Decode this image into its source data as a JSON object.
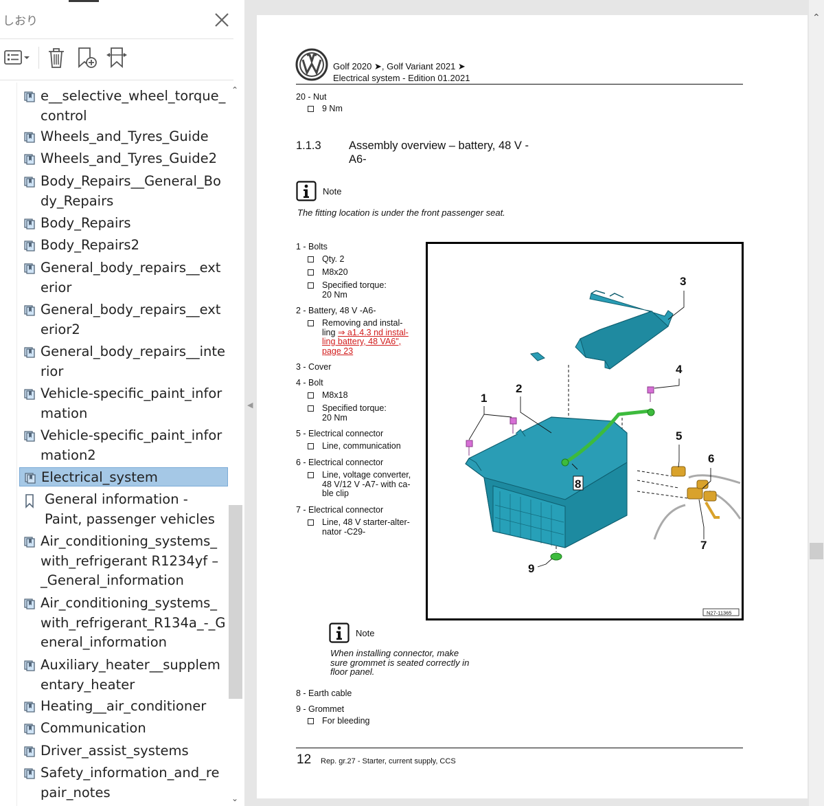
{
  "panel": {
    "title": "しおり",
    "close_icon": "close-icon",
    "toolbar": {
      "options_icon": "bookmark-options-icon",
      "delete_icon": "trash-icon",
      "new_bookmark_icon": "new-bookmark-icon",
      "expand_icon": "expand-bookmark-icon"
    }
  },
  "bookmarks": [
    {
      "label": "e__selective_wheel_torque_control",
      "icon": "bookmark-pages-icon"
    },
    {
      "label": "Wheels_and_Tyres_Guide",
      "icon": "bookmark-pages-icon"
    },
    {
      "label": "Wheels_and_Tyres_Guide2",
      "icon": "bookmark-pages-icon"
    },
    {
      "label": "Body_Repairs__General_Body_Repairs",
      "icon": "bookmark-pages-icon"
    },
    {
      "label": "Body_Repairs",
      "icon": "bookmark-pages-icon"
    },
    {
      "label": "Body_Repairs2",
      "icon": "bookmark-pages-icon"
    },
    {
      "label": "General_body_repairs__exterior",
      "icon": "bookmark-pages-icon"
    },
    {
      "label": "General_body_repairs__exterior2",
      "icon": "bookmark-pages-icon"
    },
    {
      "label": "General_body_repairs__interior",
      "icon": "bookmark-pages-icon"
    },
    {
      "label": "Vehicle-specific_paint_information",
      "icon": "bookmark-pages-icon"
    },
    {
      "label": "Vehicle-specific_paint_information2",
      "icon": "bookmark-pages-icon"
    },
    {
      "label": "Electrical_system",
      "icon": "bookmark-pages-icon",
      "selected": true
    },
    {
      "label": "General information - Paint, passenger vehicles",
      "icon": "bookmark-icon"
    },
    {
      "label": "Air_conditioning_systems_with_refrigerant R1234yf – _General_information",
      "icon": "bookmark-pages-icon"
    },
    {
      "label": "Air_conditioning_systems_with_refrigerant_R134a_-_General_information",
      "icon": "bookmark-pages-icon"
    },
    {
      "label": "Auxiliary_heater__supplementary_heater",
      "icon": "bookmark-pages-icon"
    },
    {
      "label": "Heating__air_conditioner",
      "icon": "bookmark-pages-icon"
    },
    {
      "label": "Communication",
      "icon": "bookmark-pages-icon"
    },
    {
      "label": "Driver_assist_systems",
      "icon": "bookmark-pages-icon"
    },
    {
      "label": "Safety_information_and_repair_notes",
      "icon": "bookmark-pages-icon"
    }
  ],
  "page": {
    "header": {
      "logo_icon": "vw-logo-icon",
      "line1": "Golf 2020 ➤, Golf Variant 2021 ➤",
      "line2": "Electrical system - Edition 01.2021"
    },
    "prev_item": {
      "title": "20 - Nut",
      "detail": "9 Nm"
    },
    "section": {
      "number": "1.1.3",
      "title_line1": "Assembly overview – battery, 48 V -",
      "title_line2": "A6-"
    },
    "note1": {
      "label": "Note",
      "text": "The fitting location is under the front passenger seat.",
      "icon": "info-note-icon"
    },
    "items": {
      "i1": {
        "title": "1 - Bolts",
        "d1": "Qty. 2",
        "d2": "M8x20",
        "d3a": "Specified torque:",
        "d3b": "20 Nm"
      },
      "i2": {
        "title": "2 - Battery, 48 V -A6-",
        "d1a": "Removing and instal-",
        "d1b": "ling ",
        "link1": "⇒ a1.4.3 nd instal-",
        "link2": "ling battery, 48 VA6\",",
        "link3": "page 23"
      },
      "i3": {
        "title": "3 - Cover"
      },
      "i4": {
        "title": "4 - Bolt",
        "d1": "M8x18",
        "d2a": "Specified torque:",
        "d2b": "20 Nm"
      },
      "i5": {
        "title": "5 - Electrical connector",
        "d1": "Line, communication"
      },
      "i6": {
        "title": "6 - Electrical connector",
        "d1a": "Line, voltage converter,",
        "d1b": "48 V/12 V -A7- with ca-",
        "d1c": "ble clip"
      },
      "i7": {
        "title": "7 - Electrical connector",
        "d1a": "Line, 48 V starter-alter-",
        "d1b": "nator -C29-"
      },
      "i8": {
        "title": "8 - Earth cable"
      },
      "i9": {
        "title": "9 - Grommet",
        "d1": "For bleeding"
      }
    },
    "figure": {
      "ref": "N27-11365",
      "callouts": [
        "1",
        "2",
        "3",
        "4",
        "5",
        "6",
        "7",
        "8",
        "9"
      ]
    },
    "note2": {
      "label": "Note",
      "line1": "When installing connector, make",
      "line2": "sure grommet is seated correctly in",
      "line3": "floor panel.",
      "icon": "info-note-icon"
    },
    "footer": {
      "page_number": "12",
      "text": "Rep. gr.27 - Starter, current supply, CCS"
    }
  },
  "colors": {
    "battery": "#2a9db5",
    "earth_cable": "#3dbb3d",
    "bolt": "#d76fd6",
    "connector": "#d9a22b",
    "selection": "#a5c8e6",
    "link": "#d21d1d"
  }
}
